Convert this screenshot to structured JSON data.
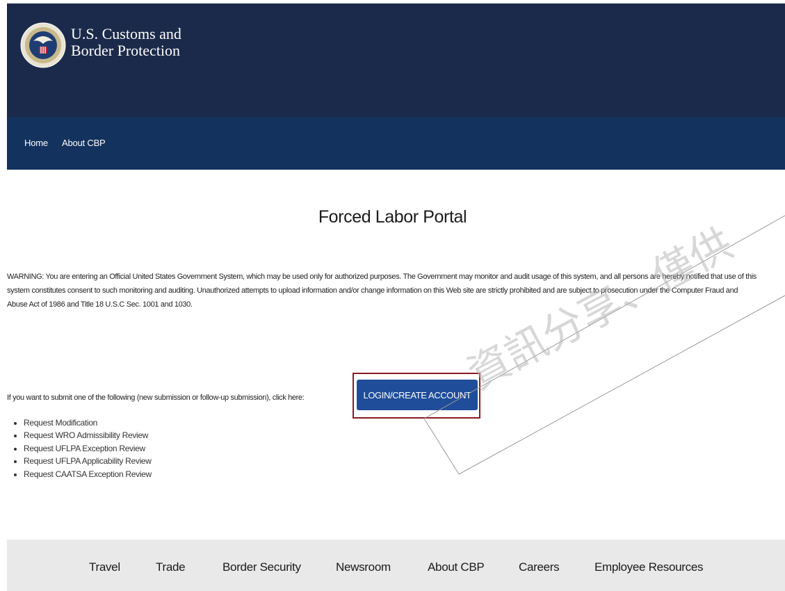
{
  "header": {
    "agency_line1": "U.S. Customs and",
    "agency_line2": "Border Protection",
    "colors": {
      "header_bg": "#1b2a4a",
      "nav_bg": "#13325d"
    },
    "seal_icon": "cbp-seal-icon"
  },
  "nav": {
    "items": [
      {
        "label": "Home"
      },
      {
        "label": "About CBP"
      }
    ]
  },
  "main": {
    "title": "Forced Labor Portal",
    "warning_lines": [
      "WARNING: You are entering an Official United States Government System, which may be used only for authorized purposes. The Government may monitor and audit usage of this system, and all persons are hereby notified that use of this",
      "system constitutes consent to such monitoring and auditing. Unauthorized attempts to upload information and/or change information on this Web site are strictly prohibited and are subject to prosecution under the Computer Fraud and",
      "Abuse Act of 1986 and Title 18 U.S.C Sec. 1001 and 1030."
    ],
    "submit_text": "If you want to submit one of the following (new submission or follow-up submission), click here:",
    "login_button": "LOGIN/CREATE ACCOUNT",
    "requests": [
      "Request Modification",
      "Request WRO Admissibility Review",
      "Request UFLPA Exception Review",
      "Request UFLPA Applicability Review",
      "Request CAATSA Exception Review"
    ],
    "colors": {
      "button": "#1f4d9a",
      "highlight_outline": "#8b1a22"
    }
  },
  "footer": {
    "links": [
      {
        "label": "Travel"
      },
      {
        "label": "Trade"
      },
      {
        "label": "Border Security"
      },
      {
        "label": "Newsroom"
      },
      {
        "label": "About CBP"
      },
      {
        "label": "Careers"
      },
      {
        "label": "Employee Resources"
      }
    ],
    "colors": {
      "footer_bg": "#e9e9e9"
    }
  },
  "watermark": {
    "text": "資訊分享、僅供"
  }
}
